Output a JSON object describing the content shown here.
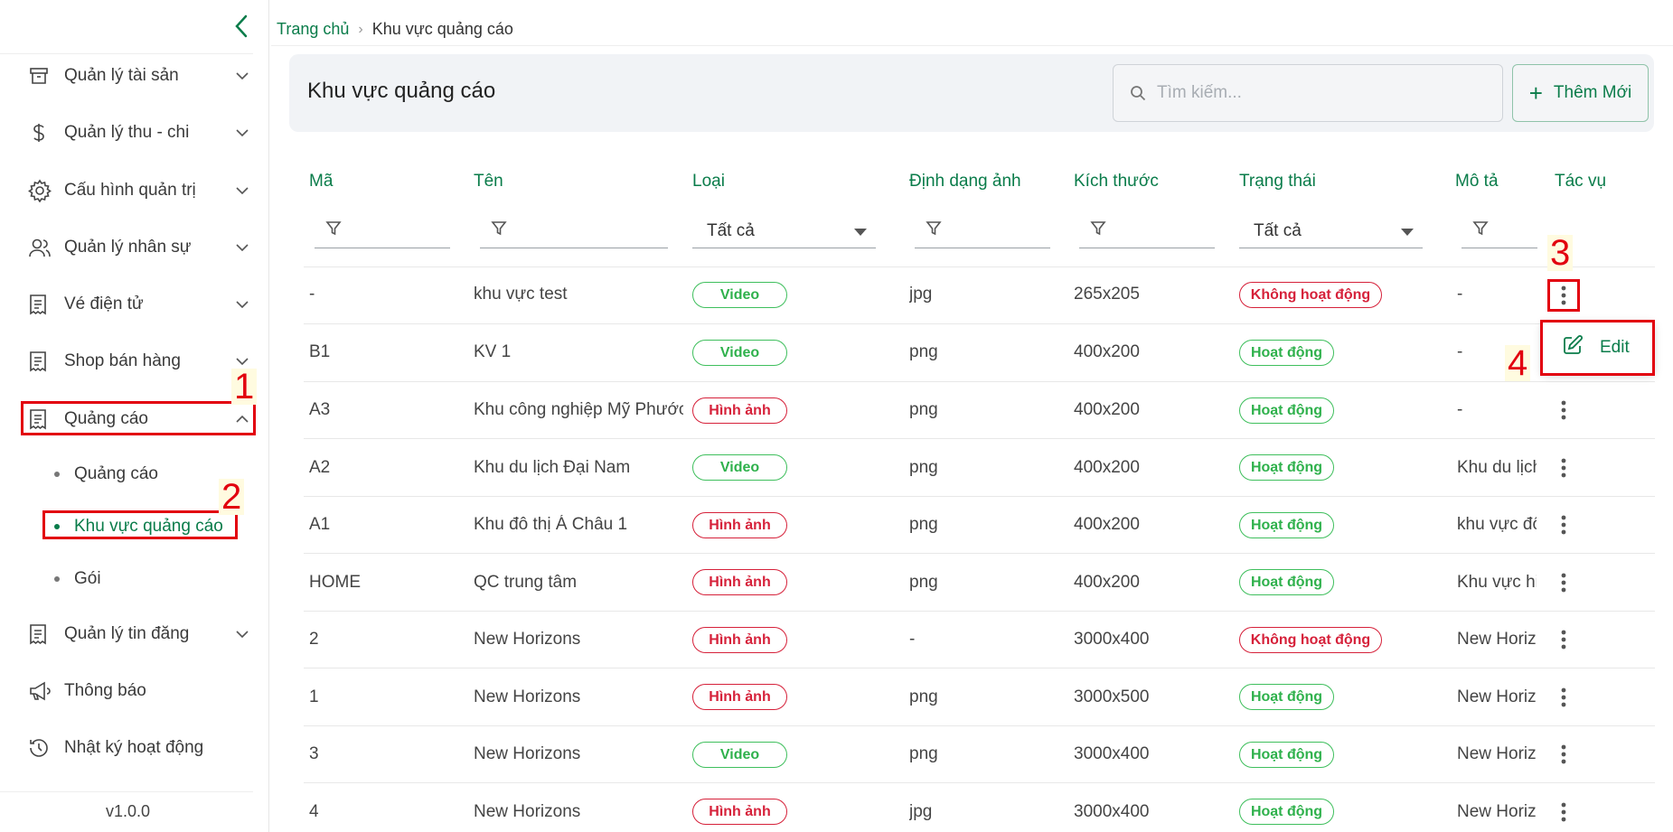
{
  "sidebar": {
    "items": [
      {
        "label": "Quản lý tài sản"
      },
      {
        "label": "Quản lý thu - chi"
      },
      {
        "label": "Cấu hình quản trị"
      },
      {
        "label": "Quản lý nhân sự"
      },
      {
        "label": "Vé điện tử"
      },
      {
        "label": "Shop bán hàng"
      },
      {
        "label": "Quảng cáo"
      },
      {
        "label": "Quản lý tin đăng"
      },
      {
        "label": "Thông báo"
      },
      {
        "label": "Nhật ký hoạt động"
      }
    ],
    "sub_items": [
      {
        "label": "Quảng cáo"
      },
      {
        "label": "Khu vực quảng cáo"
      },
      {
        "label": "Gói"
      }
    ],
    "version": "v1.0.0"
  },
  "breadcrumb": {
    "home": "Trang chủ",
    "separator": "›",
    "current": "Khu vực quảng cáo"
  },
  "header": {
    "title": "Khu vực quảng cáo",
    "search_placeholder": "Tìm kiếm...",
    "add_label": "Thêm Mới"
  },
  "table": {
    "columns": [
      "Mã",
      "Tên",
      "Loại",
      "Định dạng ảnh",
      "Kích thước",
      "Trạng thái",
      "Mô tả",
      "Tác vụ"
    ],
    "filter_select_value": "Tất cả",
    "rows": [
      {
        "code": "-",
        "name": "khu vực test",
        "type": "Video",
        "format": "jpg",
        "size": "265x205",
        "status": "Không hoạt động",
        "desc": "-"
      },
      {
        "code": "B1",
        "name": "KV 1",
        "type": "Video",
        "format": "png",
        "size": "400x200",
        "status": "Hoạt động",
        "desc": "-"
      },
      {
        "code": "A3",
        "name": "Khu công nghiệp Mỹ Phước",
        "type": "Hình ảnh",
        "format": "png",
        "size": "400x200",
        "status": "Hoạt động",
        "desc": "-"
      },
      {
        "code": "A2",
        "name": "Khu du lịch Đại Nam",
        "type": "Video",
        "format": "png",
        "size": "400x200",
        "status": "Hoạt động",
        "desc": "Khu du lịch"
      },
      {
        "code": "A1",
        "name": "Khu đô thị Á Châu 1",
        "type": "Hình ảnh",
        "format": "png",
        "size": "400x200",
        "status": "Hoạt động",
        "desc": "khu vực đô"
      },
      {
        "code": "HOME",
        "name": "QC trung tâm",
        "type": "Hình ảnh",
        "format": "png",
        "size": "400x200",
        "status": "Hoạt động",
        "desc": "Khu vực hi"
      },
      {
        "code": "2",
        "name": "New Horizons",
        "type": "Hình ảnh",
        "format": "-",
        "size": "3000x400",
        "status": "Không hoạt động",
        "desc": "New Horiz"
      },
      {
        "code": "1",
        "name": "New Horizons",
        "type": "Hình ảnh",
        "format": "png",
        "size": "3000x500",
        "status": "Hoạt động",
        "desc": "New Horiz"
      },
      {
        "code": "3",
        "name": "New Horizons",
        "type": "Video",
        "format": "png",
        "size": "3000x400",
        "status": "Hoạt động",
        "desc": "New Horiz"
      },
      {
        "code": "4",
        "name": "New Horizons",
        "type": "Hình ảnh",
        "format": "jpg",
        "size": "3000x400",
        "status": "Hoạt động",
        "desc": "New Horiz"
      }
    ]
  },
  "row_menu": {
    "edit_label": "Edit"
  },
  "annotations": [
    "1",
    "2",
    "3",
    "4"
  ],
  "colors": {
    "brand": "#0a7c4a",
    "active_pill": "#2fb14c",
    "inactive_pill": "#d6213a",
    "annotation": "#e2000f"
  }
}
